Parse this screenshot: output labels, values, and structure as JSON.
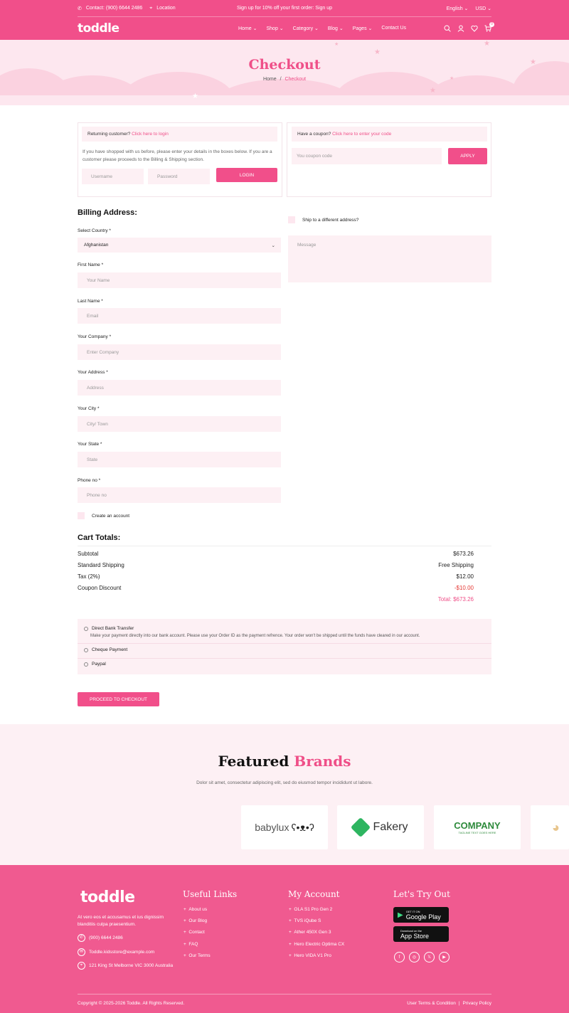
{
  "topbar": {
    "contact": "Contact: (900) 6644 2486",
    "location": "Location",
    "promo": "Sign up for 10% off your first order: Sign up",
    "language": "English",
    "currency": "USD"
  },
  "header": {
    "logo": "toddle",
    "nav": [
      "Home",
      "Shop",
      "Category",
      "Blog",
      "Pages",
      "Contact Us"
    ],
    "cart_count": "0"
  },
  "hero": {
    "title": "Checkout",
    "breadcrumb_home": "Home",
    "breadcrumb_sep": "/",
    "breadcrumb_current": "Checkout"
  },
  "login_box": {
    "prompt": "Returning customer?",
    "link": "Click here to login",
    "text": "If you have shopped with us before, please enter your details in the boxes below. If you are a customer please proceeds to the Billing & Shipping section.",
    "username_placeholder": "Username",
    "password_placeholder": "Password",
    "login_label": "LOGIN"
  },
  "coupon_box": {
    "prompt": "Have a coupon?",
    "link": "Click here to enter your code",
    "placeholder": "You coupon code",
    "apply_label": "APPLY"
  },
  "billing": {
    "title": "Billing Address:",
    "country_label": "Select Country *",
    "country_value": "Afghanistan",
    "fields": [
      {
        "label": "First Name *",
        "placeholder": "Your Name"
      },
      {
        "label": "Last Name *",
        "placeholder": "Email"
      },
      {
        "label": "Your Company *",
        "placeholder": "Enter Company"
      },
      {
        "label": "Your Address *",
        "placeholder": "Address"
      },
      {
        "label": "Your City *",
        "placeholder": "City/ Town"
      },
      {
        "label": "Your State *",
        "placeholder": "State"
      },
      {
        "label": "Phone no *",
        "placeholder": "Phone no"
      }
    ],
    "create_account": "Create an account"
  },
  "shipping": {
    "ship_different": "Ship to a different address?",
    "message_placeholder": "Message"
  },
  "cart": {
    "title": "Cart Totals:",
    "rows": [
      {
        "label": "Subtotal",
        "value": "$673.26"
      },
      {
        "label": "Standard Shipping",
        "value": "Free Shipping"
      },
      {
        "label": "Tax (2%)",
        "value": "$12.00"
      },
      {
        "label": "Coupon Discount",
        "value": "-$10.00"
      }
    ],
    "total": "Total: $673.26"
  },
  "payment": {
    "options": [
      "Direct Bank Transfer",
      "Cheque Payment",
      "Paypal"
    ],
    "bank_note": "Make your payment directly into our bank account. Please use your Order ID as the payment refrence. Your order won't be shipped until the funds have cleared in our account.",
    "proceed_label": "PROCEED TO CHECKOUT"
  },
  "brands": {
    "title_a": "Featured",
    "title_b": "Brands",
    "subtitle": "Dolor sit amet, consectetur adipiscing elit, sed do eiusmod tempor incididunt ut labore.",
    "logos": [
      "babylux",
      "Fakery",
      "COMPANY",
      "TAGLINE TEXT GOES HERE"
    ]
  },
  "footer": {
    "logo": "toddle",
    "about": "At vero eos et accusamus et ius dignissim blanditiis culpa praesentium.",
    "phone": "(900) 6644 2486",
    "email": "Toddle.kidsstore@example.com",
    "address": "121 King St Melborne VIC 3000 Australia",
    "useful_title": "Useful Links",
    "useful_links": [
      "About us",
      "Our Blog",
      "Contact",
      "FAQ",
      "Our Terms"
    ],
    "account_title": "My Account",
    "account_links": [
      "OLA S1 Pro Gen 2",
      "TVS iQube S",
      "Ather 450X Gen 3",
      "Hero Electric Optima CX",
      "Hero VIDA V1 Pro"
    ],
    "try_title": "Let's Try Out",
    "gplay_small": "GET IT ON",
    "gplay_big": "Google Play",
    "appstore_small": "Download on the",
    "appstore_big": "App Store",
    "copyright": "Copyright © 2025-2026 Toddle. All Rights Reserved.",
    "terms": "User Terms & Condition",
    "privacy": "Privacy Policy"
  },
  "colors": {
    "accent": "#f14f8a",
    "light": "#fdf0f4",
    "discount": "#e53935"
  }
}
